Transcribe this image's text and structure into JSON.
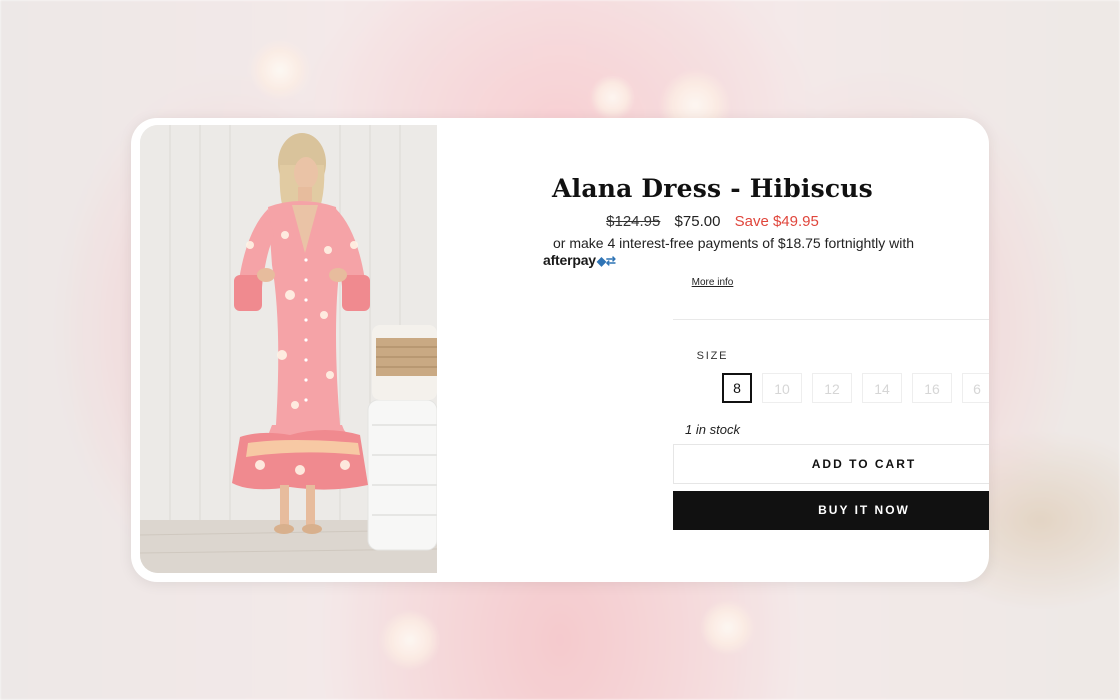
{
  "product": {
    "title": "Alana Dress - Hibiscus",
    "price": {
      "original": "$124.95",
      "sale": "$75.00",
      "save": "Save $49.95"
    },
    "installments_text": "or make 4 interest-free payments of $18.75 fortnightly with",
    "afterpay_label": "afterpay",
    "more_info": "More info",
    "size_label": "SIZE",
    "sizes": [
      {
        "label": "8",
        "selected": true,
        "available": true
      },
      {
        "label": "10",
        "selected": false,
        "available": false
      },
      {
        "label": "12",
        "selected": false,
        "available": false
      },
      {
        "label": "14",
        "selected": false,
        "available": false
      },
      {
        "label": "16",
        "selected": false,
        "available": false
      },
      {
        "label": "6",
        "selected": false,
        "available": false
      }
    ],
    "stock": "1 in stock",
    "add_to_cart": "ADD TO CART",
    "buy_now": "BUY IT NOW"
  },
  "colors": {
    "sale_red": "#e0463c",
    "buy_button": "#111111",
    "afterpay_blue": "#2f74b5",
    "dress_pink": "#f39aa0"
  },
  "icons": {
    "afterpay": "afterpay-logo-icon"
  }
}
